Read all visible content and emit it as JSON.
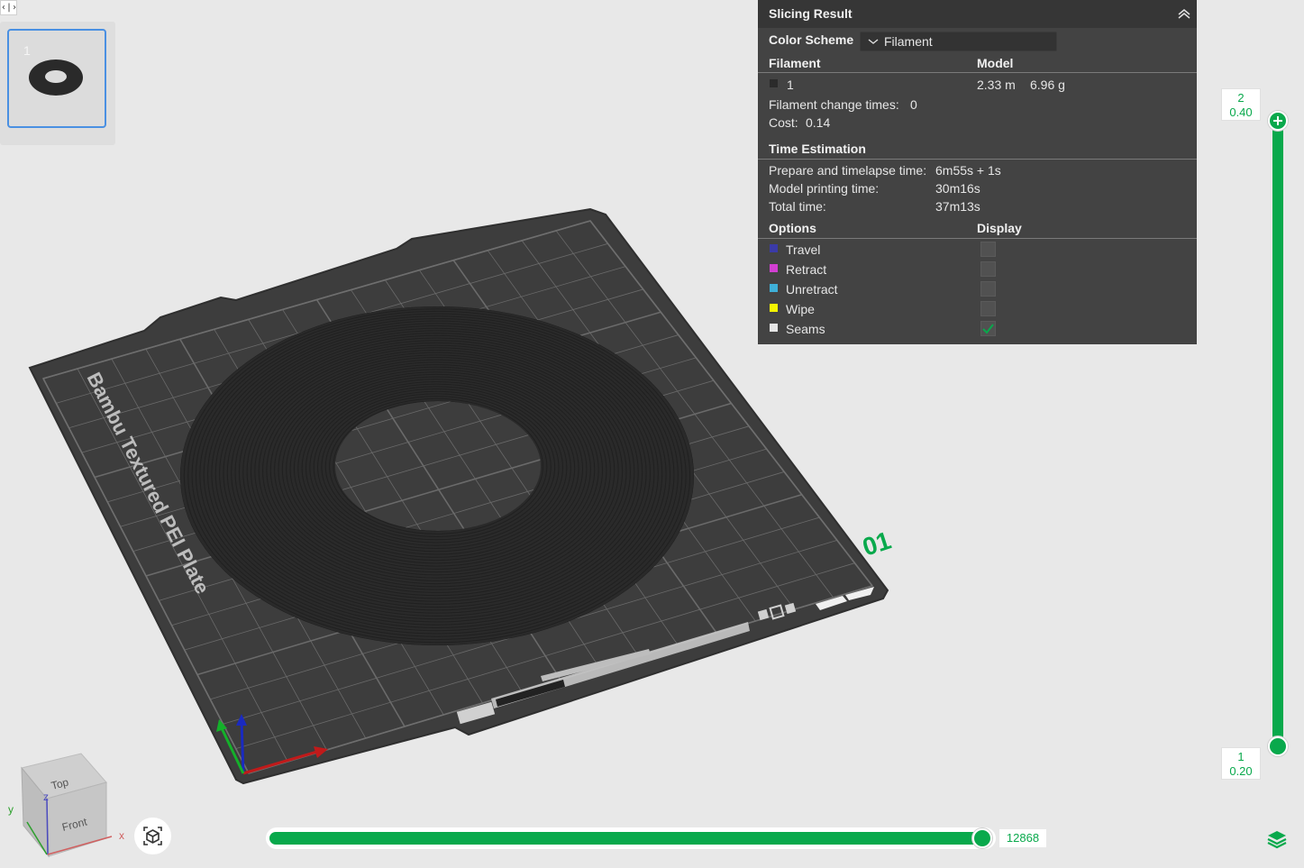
{
  "sidebar_toggle": {
    "glyph": "‹|›"
  },
  "plate_list": {
    "items": [
      {
        "number": "1",
        "selected": true
      }
    ]
  },
  "scene": {
    "plate_name": "Bambu Textured PEI Plate",
    "plate_number": "01",
    "view_cube": {
      "top": "Top",
      "front": "Front",
      "x": "x",
      "y": "y",
      "z": "z"
    }
  },
  "slicing_result": {
    "title": "Slicing Result",
    "color_scheme_label": "Color Scheme",
    "color_scheme_value": "Filament",
    "filament_header": "Filament",
    "model_header": "Model",
    "filaments": [
      {
        "id": "1",
        "color": "#2b2b2b",
        "length": "2.33 m",
        "weight": "6.96 g"
      }
    ],
    "filament_change_label": "Filament change times:",
    "filament_change_value": "0",
    "cost_label": "Cost:",
    "cost_value": "0.14",
    "time_header": "Time Estimation",
    "prepare_label": "Prepare and timelapse time:",
    "prepare_value": "6m55s + 1s",
    "model_time_label": "Model printing time:",
    "model_time_value": "30m16s",
    "total_label": "Total time:",
    "total_value": "37m13s",
    "options_header": "Options",
    "display_header": "Display",
    "options": [
      {
        "label": "Travel",
        "color": "#3b3ba8",
        "checked": false
      },
      {
        "label": "Retract",
        "color": "#d23fd2",
        "checked": false
      },
      {
        "label": "Unretract",
        "color": "#3fb0d8",
        "checked": false
      },
      {
        "label": "Wipe",
        "color": "#f5f500",
        "checked": false
      },
      {
        "label": "Seams",
        "color": "#e6e6e6",
        "checked": true
      }
    ]
  },
  "layer_slider": {
    "top_layer": "2",
    "top_height": "0.40",
    "bottom_layer": "1",
    "bottom_height": "0.20"
  },
  "move_slider": {
    "value": "12868",
    "progress": 1.0
  },
  "colors": {
    "accent": "#09a94c",
    "panel": "#434343",
    "panel_header": "#363636"
  }
}
